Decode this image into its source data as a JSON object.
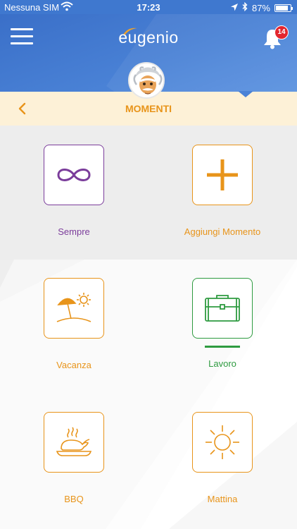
{
  "status": {
    "carrier": "Nessuna SIM",
    "time": "17:23",
    "battery": "87%",
    "battery_level": 0.87
  },
  "header": {
    "logo": "eugenio",
    "notifications_count": "14"
  },
  "page": {
    "title": "MOMENTI"
  },
  "moments": [
    {
      "label": "Sempre",
      "icon": "infinity-icon",
      "color": "#7b3d9b"
    },
    {
      "label": "Aggiungi Momento",
      "icon": "plus-icon",
      "color": "#e8941a"
    },
    {
      "label": "Vacanza",
      "icon": "beach-umbrella-icon",
      "color": "#e8941a"
    },
    {
      "label": "Lavoro",
      "icon": "briefcase-icon",
      "color": "#2e9b40",
      "selected": true
    },
    {
      "label": "BBQ",
      "icon": "roast-chicken-icon",
      "color": "#e8941a"
    },
    {
      "label": "Mattina",
      "icon": "sun-icon",
      "color": "#e8941a"
    }
  ],
  "colors": {
    "header_blue": "#3f78cf",
    "accent_orange": "#e8941a",
    "title_band": "#fdf1d7",
    "selected_green": "#2e9b40",
    "purple": "#7b3d9b",
    "badge_red": "#e3262e"
  }
}
